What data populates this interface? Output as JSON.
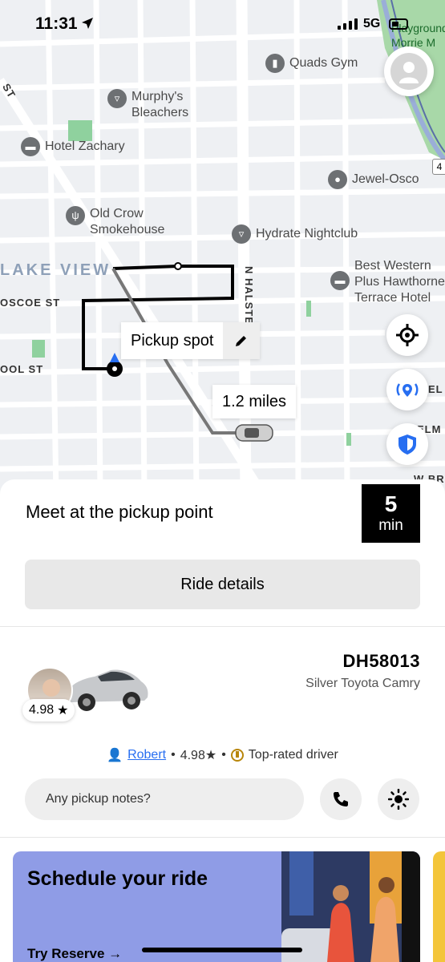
{
  "status_bar": {
    "time": "11:31",
    "network": "5G"
  },
  "map": {
    "pois": [
      {
        "name": "Quads Gym",
        "icon": "gym-icon"
      },
      {
        "name": "Murphy's Bleachers",
        "icon": "bar-icon"
      },
      {
        "name": "Hotel Zachary",
        "icon": "hotel-icon"
      },
      {
        "name": "Jewel-Osco",
        "icon": "store-icon"
      },
      {
        "name": "Old Crow Smokehouse",
        "icon": "restaurant-icon"
      },
      {
        "name": "Hydrate Nightclub",
        "icon": "bar-icon"
      },
      {
        "name": "Best Western Plus Hawthorne Terrace Hotel",
        "icon": "hotel-icon"
      }
    ],
    "park_label": "Playground Morrie M",
    "neighborhood": "LAKE VIEW",
    "streets": {
      "roscoe": "OSCOE ST",
      "school": "OOL ST",
      "halsted": "N HALSTED",
      "elm": "ELM",
      "el": "EL",
      "wbr": "W BR",
      "st": "ST"
    },
    "pickup_label": "Pickup spot",
    "distance_label": "1.2 miles",
    "route_badge": "4"
  },
  "sheet": {
    "title": "Meet at the pickup point",
    "eta_value": "5",
    "eta_unit": "min",
    "ride_details_label": "Ride details",
    "plate": "DH58013",
    "car_model": "Silver Toyota Camry",
    "driver_rating": "4.98",
    "driver_name": "Robert",
    "driver_rating_inline": "4.98★",
    "driver_badge": "Top-rated driver",
    "notes_placeholder": "Any pickup notes?",
    "promo_title": "Schedule your ride",
    "promo_cta": "Try Reserve →"
  },
  "colors": {
    "accent_blue": "#276ef1",
    "eta_bg": "#000000",
    "promo_bg": "#8f9ce6"
  }
}
